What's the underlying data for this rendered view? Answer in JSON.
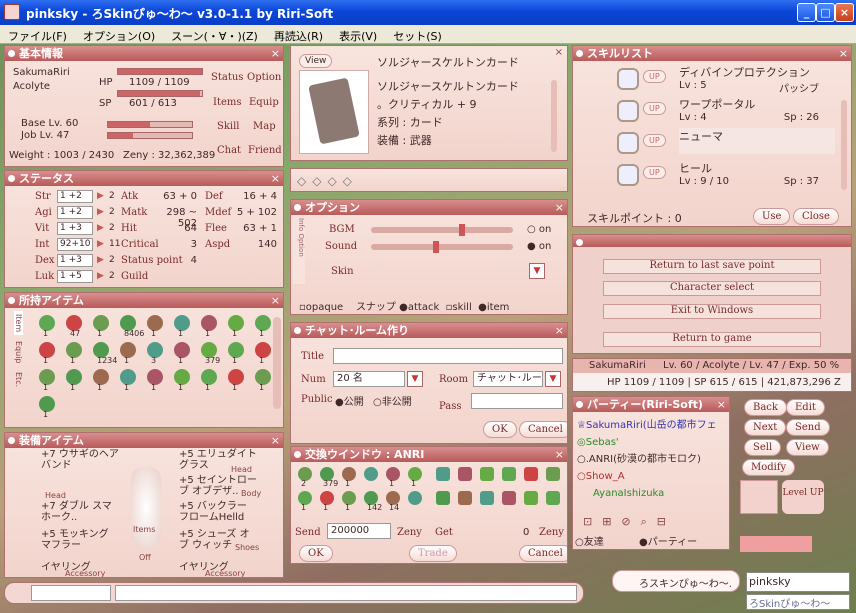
{
  "window": {
    "title": "pinksky - ろSkinぴゅ～わ～ v3.0-1.1 by Riri-Soft"
  },
  "menu": [
    "ファイル(F)",
    "オプション(O)",
    "スーン(・∀・)(Z)",
    "再読込(R)",
    "表示(V)",
    "セット(S)"
  ],
  "basic": {
    "title": "基本情報",
    "name": "SakumaRiri",
    "job": "Acolyte",
    "hp_label": "HP",
    "hp": "1109 / 1109",
    "sp_label": "SP",
    "sp": "601 / 613",
    "hp_frac": 1.0,
    "sp_frac": 0.98,
    "base": "Base Lv. 60",
    "joblv": "Job Lv. 47",
    "weight": "Weight : 1003 / 2430",
    "zeny": "Zeny : 32,362,389",
    "buttons": [
      "Status",
      "Option",
      "Items",
      "Equip",
      "Skill",
      "Map",
      "Chat",
      "Friend"
    ]
  },
  "status": {
    "title": "ステータス",
    "stats": [
      [
        "Str",
        "1 +2",
        "2"
      ],
      [
        "Agi",
        "1 +2",
        "2"
      ],
      [
        "Vit",
        "1 +3",
        "2"
      ],
      [
        "Int",
        "92+10",
        "11"
      ],
      [
        "Dex",
        "1 +3",
        "2"
      ],
      [
        "Luk",
        "1 +5",
        "2"
      ]
    ],
    "right": [
      [
        "Atk",
        "63 + 0",
        "Def",
        "16 + 4"
      ],
      [
        "Matk",
        "298 ~ 502",
        "Mdef",
        "5 + 102"
      ],
      [
        "Hit",
        "64",
        "Flee",
        "63 + 1"
      ],
      [
        "Critical",
        "3",
        "Aspd",
        "140"
      ],
      [
        "Status point",
        "4",
        "",
        ""
      ],
      [
        "Guild",
        "",
        "",
        ""
      ]
    ]
  },
  "items": {
    "title": "所持アイテム",
    "tabs": [
      "Item",
      "Equip",
      "Etc."
    ],
    "counts": [
      "1",
      "47",
      "1",
      "8406",
      "1",
      "1",
      "1",
      "1",
      "1",
      "1",
      "1",
      "1234",
      "1",
      "3",
      "1",
      "379",
      "1",
      "1",
      "1",
      "1",
      "1",
      "1",
      "1",
      "1",
      "1",
      "1",
      "1",
      "1"
    ]
  },
  "equip": {
    "title": "装備アイテム",
    "left": [
      "+7 ウサギのヘアバンド",
      "+7 ダブル スマ ホーク..",
      "+5 モッキング マフラー",
      "イヤリング"
    ],
    "right": [
      "+5 エリュダイト グラス",
      "+5 セイントローブ オブデザ..",
      "+5 バックラー フロームHelld",
      "+5 シューズ オブ ウィッチ",
      "イヤリング"
    ],
    "labels": [
      "Head",
      "Head",
      "Body",
      "Items",
      "Off",
      "Shoes",
      "Accessory",
      "Accessory"
    ]
  },
  "card": {
    "view": "View",
    "title": "ソルジャースケルトンカード",
    "name": "ソルジャースケルトンカード",
    "l2": "。クリティカル + 9",
    "l3": "系列 : カード",
    "l4": "装備 : 武器"
  },
  "option": {
    "title": "オプション",
    "side": "Info Option",
    "bgm": "BGM",
    "sound": "Sound",
    "skin": "Skin",
    "on": "on",
    "bottom": [
      "opaque",
      "スナップ",
      "attack",
      "skill",
      "item"
    ]
  },
  "chat": {
    "title": "チャット･ルーム作り",
    "title_label": "Title",
    "num_label": "Num",
    "num": "20 名",
    "room_label": "Room",
    "room": "チャット･ルー",
    "public_label": "Public",
    "pub1": "公開",
    "pub2": "非公開",
    "pass_label": "Pass",
    "ok": "OK",
    "cancel": "Cancel"
  },
  "trade": {
    "title": "交換ウインドウ : ANRI",
    "send": "Send",
    "send_val": "200000",
    "zeny": "Zeny",
    "get": "Get",
    "get_val": "0",
    "zeny2": "Zeny",
    "ok": "OK",
    "trade": "Trade",
    "cancel": "Cancel",
    "lcounts": [
      "2",
      "379",
      "1",
      "",
      "1",
      "1",
      "1",
      "1",
      "1",
      "142",
      "14",
      ""
    ]
  },
  "skills": {
    "title": "スキルリスト",
    "list": [
      {
        "n": "ディバインプロテクション",
        "lv": "Lv : 5",
        "t": "パッシブ"
      },
      {
        "n": "ワープポータル",
        "lv": "Lv : 4",
        "t": "Sp : 26"
      },
      {
        "n": "ニューマ",
        "lv": "",
        "t": ""
      },
      {
        "n": "ヒール",
        "lv": "Lv : 9 / 10",
        "t": "Sp : 37"
      }
    ],
    "up": "UP",
    "points": "スキルポイント : 0",
    "use": "Use",
    "close": "Close"
  },
  "menu2": {
    "items": [
      "Return to last save point",
      "Character select",
      "Exit to Windows",
      "Return to game"
    ]
  },
  "char": {
    "name": "SakumaRiri",
    "info": "Lv. 60 / Acolyte / Lv. 47 / Exp. 50 %",
    "hp": "HP 1109 / 1109  |  SP 615 / 615  |  421,873,296 Z"
  },
  "party": {
    "title": "パーティー(Riri-Soft)",
    "members": [
      "SakumaRiri(山岳の都市フェ",
      "Sebas'",
      ".ANRI(砂漠の都市モロク)",
      "Show_A",
      "AyanaIshizuka"
    ],
    "tab1": "友達",
    "tab2": "パーティー"
  },
  "side": {
    "buttons": [
      "Back",
      "Edit",
      "Next",
      "Send",
      "Sell",
      "View",
      "Modify"
    ],
    "levelup": "Level UP"
  },
  "bottom": {
    "chatname": "pinksky",
    "skin": "ろスキンぴゅ～わ～.",
    "brand": "ろSkinぴゅ～わ～"
  }
}
